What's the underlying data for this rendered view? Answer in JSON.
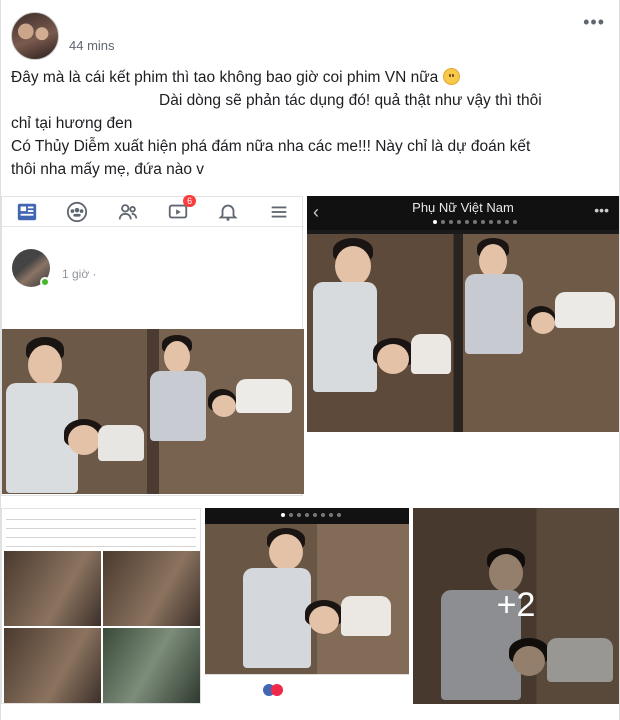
{
  "post": {
    "timestamp": "44 mins",
    "more_icon": "ellipsis-icon",
    "text_line1": "Đây mà là cái kết phim thì tao không bao giờ coi phim VN nữa",
    "text_line2": "Dài dòng sẽ phản tác dụng đó! quả thật như vậy thì thôi",
    "text_line3": "chỉ tại hương đen",
    "text_line4": "Có Thủy Diễm xuất hiện phá đám nữa nha các me!!! Này chỉ là dự đoán kết",
    "text_line5": "thôi nha mấy mẹ, đứa nào v"
  },
  "screenshot1": {
    "tabs": [
      {
        "icon": "news-feed-icon"
      },
      {
        "icon": "groups-icon"
      },
      {
        "icon": "friends-icon"
      },
      {
        "icon": "watch-icon",
        "badge": "6"
      },
      {
        "icon": "bell-icon"
      },
      {
        "icon": "menu-icon"
      }
    ],
    "time": "1 giờ ·"
  },
  "screenshot2": {
    "title": "Phụ Nữ Việt Nam",
    "back_icon": "chevron-left-icon",
    "more_icon": "ellipsis-icon"
  },
  "gallery": {
    "more_count": "+2"
  },
  "colors": {
    "accent": "#4267b2",
    "badge": "#fa3e3e",
    "online": "#42b72a"
  }
}
